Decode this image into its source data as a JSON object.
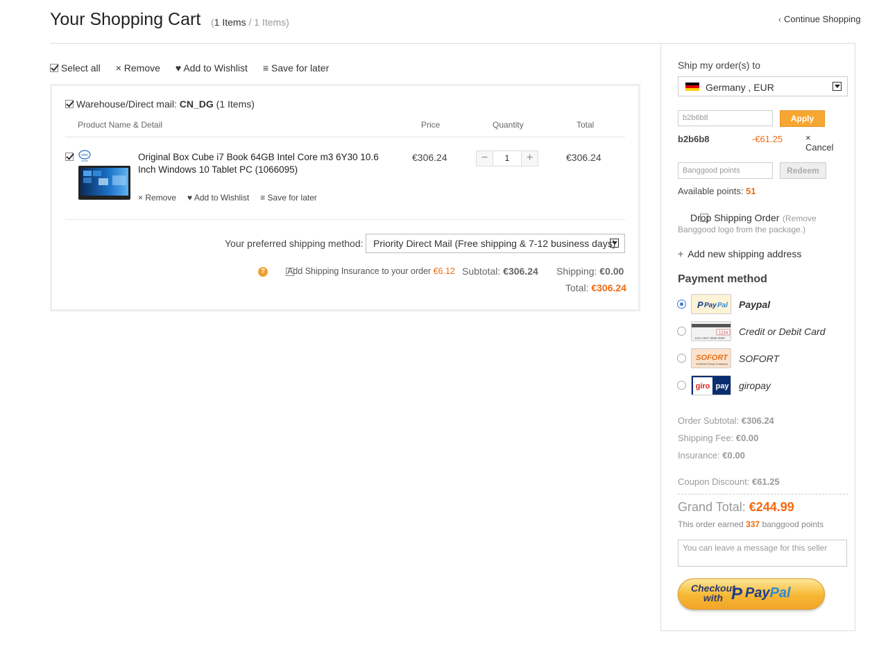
{
  "header": {
    "title": "Your Shopping Cart",
    "count_open": "(",
    "count_selected": "1 Items",
    "count_sep": " / ",
    "count_total": "1 Items",
    "count_close": ")",
    "continue_label": "Continue Shopping"
  },
  "toolbar": {
    "select_all": "Select all",
    "remove": "× Remove",
    "wishlist": "♥ Add to Wishlist",
    "save_later": "≡ Save for later"
  },
  "cart": {
    "warehouse_prefix": "Warehouse/Direct mail:",
    "warehouse_code": "CN_DG",
    "warehouse_count": "(1 Items)",
    "columns": {
      "product": "Product Name & Detail",
      "price": "Price",
      "quantity": "Quantity",
      "total": "Total"
    },
    "item": {
      "name": "Original Box Cube i7 Book 64GB Intel Core m3 6Y30 10.6 Inch Windows 10 Tablet PC (1066095)",
      "price": "€306.24",
      "quantity": "1",
      "total": "€306.24",
      "remove": "× Remove",
      "wishlist": "♥ Add to Wishlist",
      "save_later": "≡ Save for later"
    },
    "shipping_method_label": "Your preferred shipping method:",
    "shipping_method_value": "Priority Direct Mail (Free shipping & 7-12 business days)",
    "insurance_label": "Add Shipping Insurance to your order",
    "insurance_price": "€6.12",
    "subtotal_label": "Subtotal:",
    "subtotal_value": "€306.24",
    "shipping_label": "Shipping:",
    "shipping_value": "€0.00",
    "total_label": "Total:",
    "total_value": "€306.24"
  },
  "sidebar": {
    "ship_to_label": "Ship my order(s) to",
    "country": "Germany , EUR",
    "coupon_input_value": "b2b6b8",
    "apply_label": "Apply",
    "applied_code": "b2b6b8",
    "applied_discount": "-€61.25",
    "cancel_label": "× Cancel",
    "points_placeholder": "Banggood points",
    "redeem_label": "Redeem",
    "available_points_label": "Available points:",
    "available_points": "51",
    "drop_shipping_label": "Drop Shipping Order",
    "drop_shipping_note1": "(Remove",
    "drop_shipping_note2": "Banggood logo from the package.)",
    "add_address_label": "Add new shipping address",
    "payment_title": "Payment method",
    "payment_methods": [
      {
        "label": "Paypal",
        "selected": true
      },
      {
        "label": "Credit or Debit Card",
        "selected": false
      },
      {
        "label": "SOFORT",
        "selected": false
      },
      {
        "label": "giropay",
        "selected": false
      }
    ],
    "order_subtotal_label": "Order Subtotal:",
    "order_subtotal": "€306.24",
    "shipping_fee_label": "Shipping Fee:",
    "shipping_fee": "€0.00",
    "insurance_label": "Insurance:",
    "insurance": "€0.00",
    "coupon_discount_label": "Coupon Discount:",
    "coupon_discount": "€61.25",
    "grand_total_label": "Grand Total:",
    "grand_total": "€244.99",
    "earned_prefix": "This order earned",
    "earned_points": "337",
    "earned_suffix": "banggood points",
    "message_placeholder": "You can leave a message for this seller",
    "checkout_line1": "Checkout",
    "checkout_line2": "with",
    "checkout_pay": "Pay",
    "checkout_pal": "Pal"
  },
  "logos": {
    "paypal_pay": "Pay",
    "paypal_pal": "Pal",
    "card_number": "1234 4567 8888 8888",
    "card_code": "1234",
    "sofort": "SOFORT",
    "sofort_sub": "A Klarna Group Company",
    "giro": "giro",
    "pay": "pay",
    "intel": "intel",
    "inside": "inside"
  },
  "colors": {
    "accent": "#f26a10",
    "apply_button": "#f6a732",
    "radio_selected": "#3a7bd5"
  }
}
